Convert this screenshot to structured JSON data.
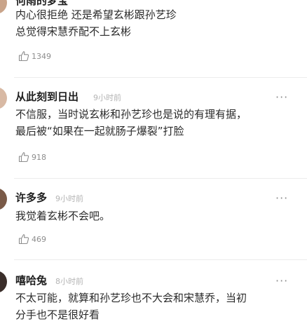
{
  "comments": [
    {
      "name": "何雨的梦宝",
      "time": "",
      "text_lines": [
        "内心很拒绝  还是希望玄彬跟孙艺珍",
        "总觉得宋慧乔配不上玄彬"
      ],
      "likes": "1349",
      "avatar_color": "#c9a48a"
    },
    {
      "name": "从此刻到日出",
      "time": "9小时前",
      "text_lines": [
        "不信服，当时说玄彬和孙艺珍也是说的有理有据，",
        "最后被“如果在一起就肠子爆裂”打脸"
      ],
      "likes": "918",
      "avatar_color": "#d8b9a4"
    },
    {
      "name": "许多多",
      "time": "9小时前",
      "text_lines": [
        "我觉着玄彬不会吧。"
      ],
      "likes": "469",
      "avatar_color": "#7a5a48"
    },
    {
      "name": "嘻哈兔",
      "time": "8小时前",
      "text_lines": [
        "不太可能，就算和孙艺珍也不大会和宋慧乔，当初",
        "分手也不是很好看"
      ],
      "likes": "",
      "avatar_color": "#3a2e2a"
    }
  ],
  "more_label": "···",
  "icons": {
    "like": "thumbs-up-icon",
    "more": "more-icon"
  }
}
